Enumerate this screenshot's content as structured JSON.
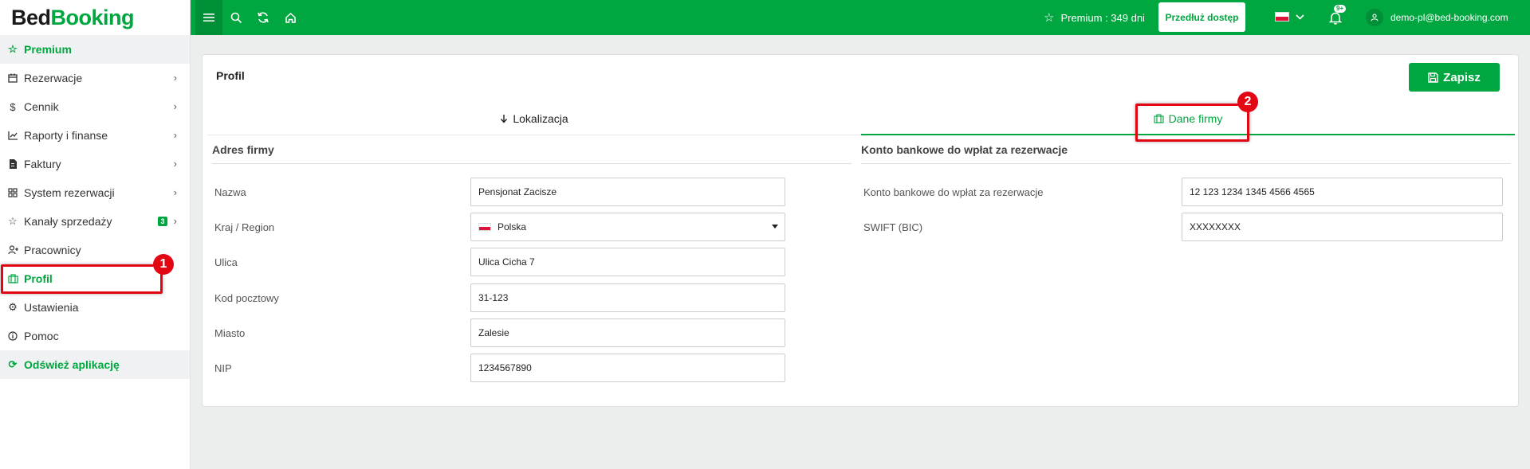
{
  "logo": {
    "part1": "Bed",
    "part2": "Booking"
  },
  "sidebar": {
    "items": [
      {
        "label": "Premium",
        "icon": "star-icon"
      },
      {
        "label": "Rezerwacje",
        "icon": "calendar-icon"
      },
      {
        "label": "Cennik",
        "icon": "dollar-icon"
      },
      {
        "label": "Raporty i finanse",
        "icon": "chart-icon"
      },
      {
        "label": "Faktury",
        "icon": "invoice-icon"
      },
      {
        "label": "System rezerwacji",
        "icon": "grid-icon"
      },
      {
        "label": "Kanały sprzedaży",
        "icon": "star-outline-icon",
        "badge": "3"
      },
      {
        "label": "Pracownicy",
        "icon": "user-plus-icon"
      },
      {
        "label": "Profil",
        "icon": "building-icon"
      },
      {
        "label": "Ustawienia",
        "icon": "gear-icon"
      },
      {
        "label": "Pomoc",
        "icon": "info-icon"
      },
      {
        "label": "Odśwież aplikację",
        "icon": "refresh-icon"
      }
    ]
  },
  "topbar": {
    "premium_text": "Premium : 349 dni",
    "extend_label": "Przedłuż dostęp",
    "notification_badge": "9+",
    "user_email": "demo-pl@bed-booking.com",
    "accent": "#00a63f"
  },
  "page": {
    "title": "Profil",
    "save_label": "Zapisz",
    "tabs": [
      {
        "label": "Lokalizacja"
      },
      {
        "label": "Dane firmy"
      }
    ]
  },
  "company": {
    "section_title": "Adres firmy",
    "fields": [
      {
        "label": "Nazwa",
        "value": "Pensjonat Zacisze"
      },
      {
        "label": "Kraj / Region",
        "value": "Polska"
      },
      {
        "label": "Ulica",
        "value": "Ulica Cicha 7"
      },
      {
        "label": "Kod pocztowy",
        "value": "31-123"
      },
      {
        "label": "Miasto",
        "value": "Zalesie"
      },
      {
        "label": "NIP",
        "value": "1234567890"
      }
    ]
  },
  "bank": {
    "section_title": "Konto bankowe do wpłat za rezerwacje",
    "fields": [
      {
        "label": "Konto bankowe do wpłat za rezerwacje",
        "value": "12 123 1234 1345 4566 4565"
      },
      {
        "label": "SWIFT (BIC)",
        "value": "XXXXXXXX"
      }
    ]
  },
  "annotations": {
    "first": "1",
    "second": "2",
    "color": "#e30613"
  }
}
